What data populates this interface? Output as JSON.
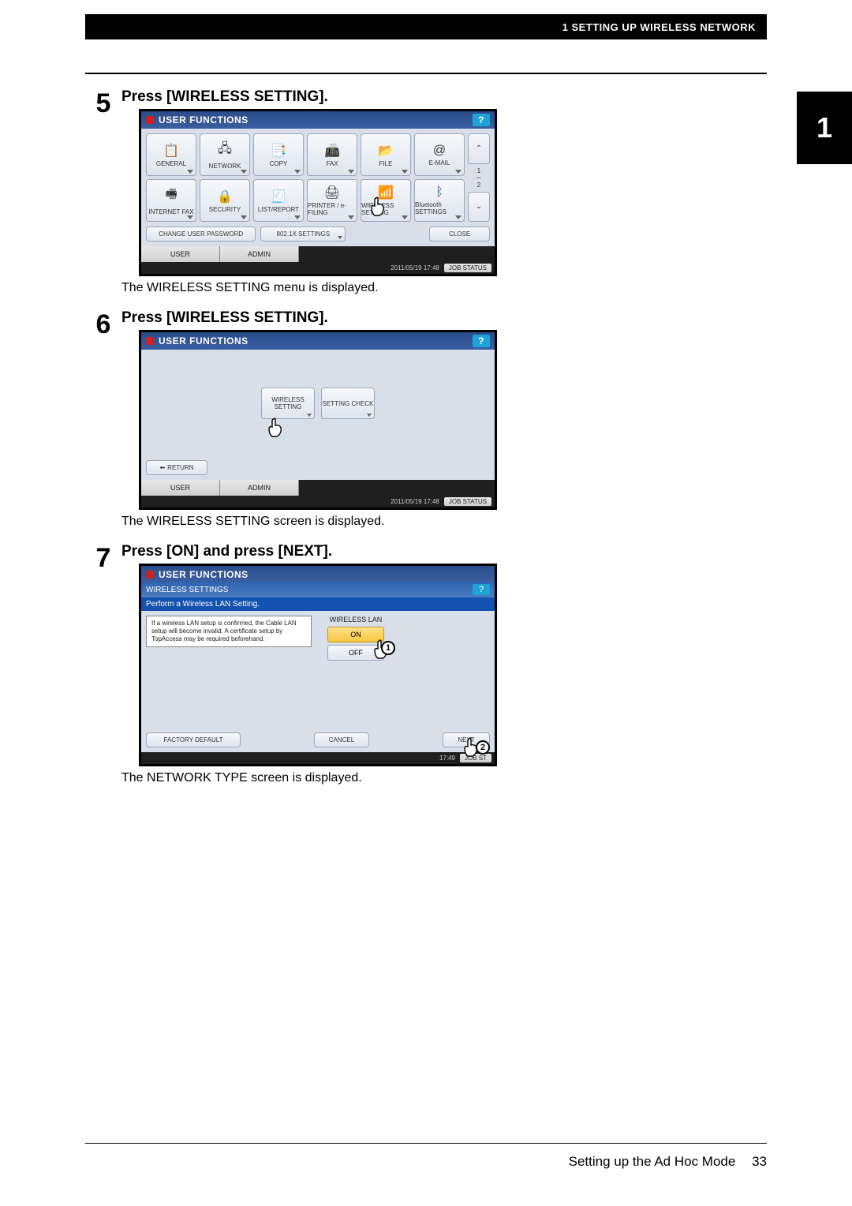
{
  "header": {
    "breadcrumb": "1 SETTING UP WIRELESS NETWORK"
  },
  "chapter_tab": "1",
  "steps": [
    {
      "num": "5",
      "title": "Press [WIRELESS SETTING].",
      "result": "The WIRELESS SETTING menu is displayed.",
      "screen": {
        "title": "USER FUNCTIONS",
        "help": "?",
        "row1": [
          {
            "label": "GENERAL",
            "icon": "📋"
          },
          {
            "label": "NETWORK",
            "icon": "🖧"
          },
          {
            "label": "COPY",
            "icon": "📑"
          },
          {
            "label": "FAX",
            "icon": "📠"
          },
          {
            "label": "FILE",
            "icon": "📂"
          },
          {
            "label": "E-MAIL",
            "icon": "@"
          }
        ],
        "row2": [
          {
            "label": "INTERNET FAX",
            "icon": "🖷"
          },
          {
            "label": "SECURITY",
            "icon": "🔒"
          },
          {
            "label": "LIST/REPORT",
            "icon": "🧾"
          },
          {
            "label": "PRINTER / e-FILING",
            "icon": "🖨"
          },
          {
            "label": "WIRELESS SETTING",
            "icon": "📶"
          },
          {
            "label": "Bluetooth SETTINGS",
            "icon": "ᛒ"
          }
        ],
        "page_indicator_top": "1",
        "page_indicator_bottom": "2",
        "scroll_up": "⌃",
        "scroll_down": "⌄",
        "small_buttons": [
          "CHANGE USER PASSWORD",
          "802.1X SETTINGS",
          "CLOSE"
        ],
        "tabs": [
          "USER",
          "ADMIN"
        ],
        "timestamp": "2011/05/19 17:48",
        "job_status": "JOB STATUS"
      }
    },
    {
      "num": "6",
      "title": "Press [WIRELESS SETTING].",
      "result": "The WIRELESS SETTING screen is displayed.",
      "screen": {
        "title": "USER FUNCTIONS",
        "help": "?",
        "buttons": [
          "WIRELESS SETTING",
          "SETTING CHECK"
        ],
        "return": "RETURN",
        "tabs": [
          "USER",
          "ADMIN"
        ],
        "timestamp": "2011/05/19 17:48",
        "job_status": "JOB STATUS"
      }
    },
    {
      "num": "7",
      "title": "Press [ON] and press [NEXT].",
      "result": "The NETWORK TYPE screen is displayed.",
      "screen": {
        "title": "USER FUNCTIONS",
        "subheader": "WIRELESS SETTINGS",
        "help": "?",
        "blue_strip": "Perform a Wireless LAN Setting.",
        "note": "If a wireless LAN setup is confirmed, the Cable LAN setup will become invalid. A certificate setup by TopAccess may be required beforehand.",
        "wlan_label": "WIRELESS LAN",
        "on_label": "ON",
        "off_label": "OFF",
        "callout1": "1",
        "callout2": "2",
        "bottom_buttons": [
          "FACTORY DEFAULT",
          "CANCEL",
          "NEXT"
        ],
        "timestamp": "17:49",
        "job_status": "JOB ST"
      }
    }
  ],
  "footer": {
    "section": "Setting up the Ad Hoc Mode",
    "page": "33"
  }
}
